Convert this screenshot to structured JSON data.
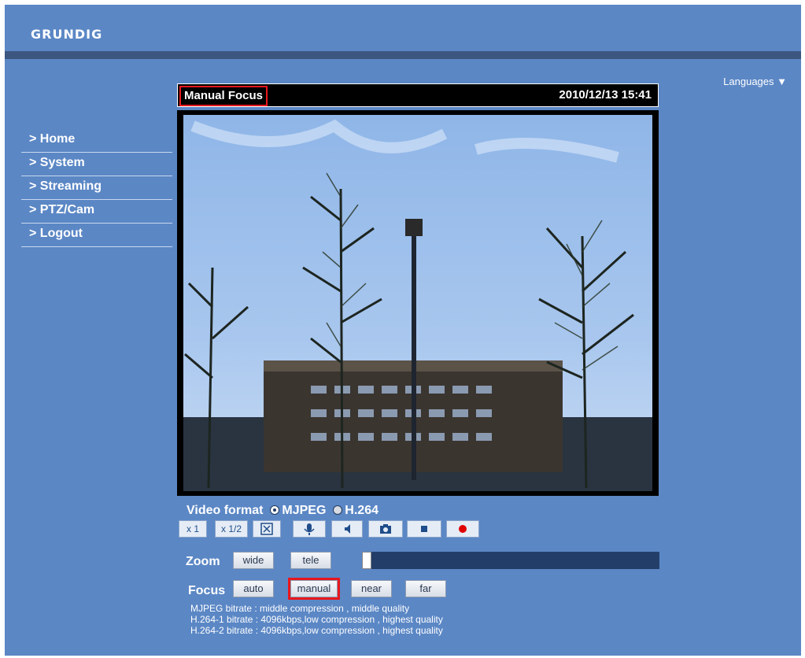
{
  "header": {
    "logo_text": "GRUNDIG",
    "languages_label": "Languages ▼"
  },
  "sidebar": {
    "items": [
      {
        "label": "> Home"
      },
      {
        "label": "> System"
      },
      {
        "label": "> Streaming"
      },
      {
        "label": "> PTZ/Cam"
      },
      {
        "label": "> Logout"
      }
    ]
  },
  "viewer": {
    "title": "Manual Focus",
    "timestamp": "2010/12/13 15:41"
  },
  "controls": {
    "video_format_label": "Video format",
    "format_options": [
      "MJPEG",
      "H.264"
    ],
    "selected_format": "MJPEG",
    "x1_label": "x 1",
    "x12_label": "x 1/2",
    "zoom_label": "Zoom",
    "wide_label": "wide",
    "tele_label": "tele",
    "zoom_level": 0.0,
    "focus_label": "Focus",
    "auto_label": "auto",
    "manual_label": "manual",
    "near_label": "near",
    "far_label": "far"
  },
  "info_lines": [
    "MJPEG bitrate : middle compression , middle quality",
    "H.264-1 bitrate : 4096kbps,low compression , highest quality",
    "H.264-2 bitrate : 4096kbps,low compression , highest quality"
  ],
  "icons": [
    "fullscreen-icon",
    "microphone-icon",
    "speaker-icon",
    "camera-icon",
    "stop-icon",
    "record-icon",
    "dropdown-arrow-icon"
  ],
  "colors": {
    "background": "#5b87c5",
    "header_bar": "#3d5680",
    "highlight": "#e8171d",
    "record": "#e00000"
  }
}
